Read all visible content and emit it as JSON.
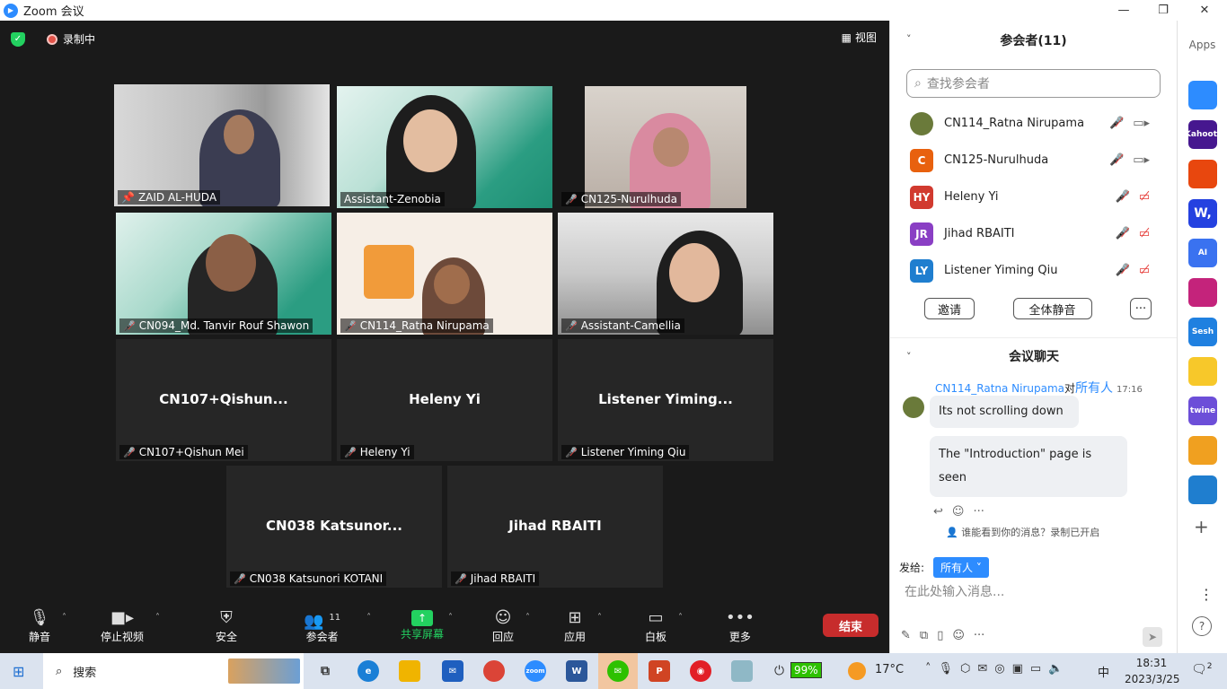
{
  "window": {
    "title": "Zoom 会议"
  },
  "topbar": {
    "recording": "录制中",
    "view": "视图"
  },
  "tiles": [
    {
      "name": "ZAID AL-HUDA",
      "center": ""
    },
    {
      "name": "Assistant-Zenobia",
      "center": ""
    },
    {
      "name": "CN125-Nurulhuda",
      "center": ""
    },
    {
      "name": "CN094_Md. Tanvir Rouf Shawon",
      "center": ""
    },
    {
      "name": "CN114_Ratna Nirupama",
      "center": ""
    },
    {
      "name": "Assistant-Camellia",
      "center": ""
    },
    {
      "name": "CN107+Qishun Mei",
      "center": "CN107+Qishun..."
    },
    {
      "name": "Heleny Yi",
      "center": "Heleny Yi"
    },
    {
      "name": "Listener Yiming Qiu",
      "center": "Listener  Yiming..."
    },
    {
      "name": "CN038 Katsunori KOTANI",
      "center": "CN038  Katsunor..."
    },
    {
      "name": "Jihad RBAITI",
      "center": "Jihad RBAITI"
    }
  ],
  "toolbar": {
    "mute": "静音",
    "video": "停止视频",
    "security": "安全",
    "participants": "参会者",
    "participants_count": "11",
    "share": "共享屏幕",
    "reactions": "回应",
    "apps": "应用",
    "whiteboard": "白板",
    "more": "更多",
    "end": "结束"
  },
  "panel": {
    "title": "参会者(11)",
    "search_placeholder": "查找参会者",
    "participants": [
      {
        "initials": "",
        "name": "CN114_Ratna Nirupama",
        "color": "#6a7a3a"
      },
      {
        "initials": "C",
        "name": "CN125-Nurulhuda",
        "color": "#e8610e"
      },
      {
        "initials": "HY",
        "name": "Heleny Yi",
        "color": "#d13a2f"
      },
      {
        "initials": "JR",
        "name": "Jihad RBAITI",
        "color": "#8a3fc4"
      },
      {
        "initials": "LY",
        "name": "Listener Yiming Qiu",
        "color": "#1f7ecf"
      }
    ],
    "invite": "邀请",
    "mute_all": "全体静音",
    "more": "···"
  },
  "chat": {
    "title": "会议聊天",
    "sender": "CN114_Ratna Nirupama",
    "to_word": "对",
    "recipient": "所有人",
    "time": "17:16",
    "messages": [
      "Its not scrolling down",
      "The \"Introduction\" page is seen"
    ],
    "who_can_see": "谁能看到你的消息？录制已开启",
    "send_to_label": "发给:",
    "send_to": "所有人",
    "input_placeholder": "在此处输入消息..."
  },
  "rail": {
    "title": "Apps",
    "apps": [
      {
        "label": "",
        "color": "#2d8cff"
      },
      {
        "label": "Kahoot!",
        "color": "#46178f"
      },
      {
        "label": "",
        "color": "#e8470e"
      },
      {
        "label": "W,",
        "color": "#2441e0"
      },
      {
        "label": "AI",
        "color": "#3a72f0"
      },
      {
        "label": "",
        "color": "#c4237b"
      },
      {
        "label": "Sesh",
        "color": "#1f80e0"
      },
      {
        "label": "",
        "color": "#f7c82a"
      },
      {
        "label": "twine",
        "color": "#6c4ed8"
      },
      {
        "label": "",
        "color": "#f0a020"
      },
      {
        "label": "",
        "color": "#1f7ecf"
      }
    ]
  },
  "taskbar": {
    "search": "搜索",
    "battery": "99%",
    "temperature": "17°C",
    "ime": "中",
    "time": "18:31",
    "date": "2023/3/25",
    "notif_count": "2"
  }
}
